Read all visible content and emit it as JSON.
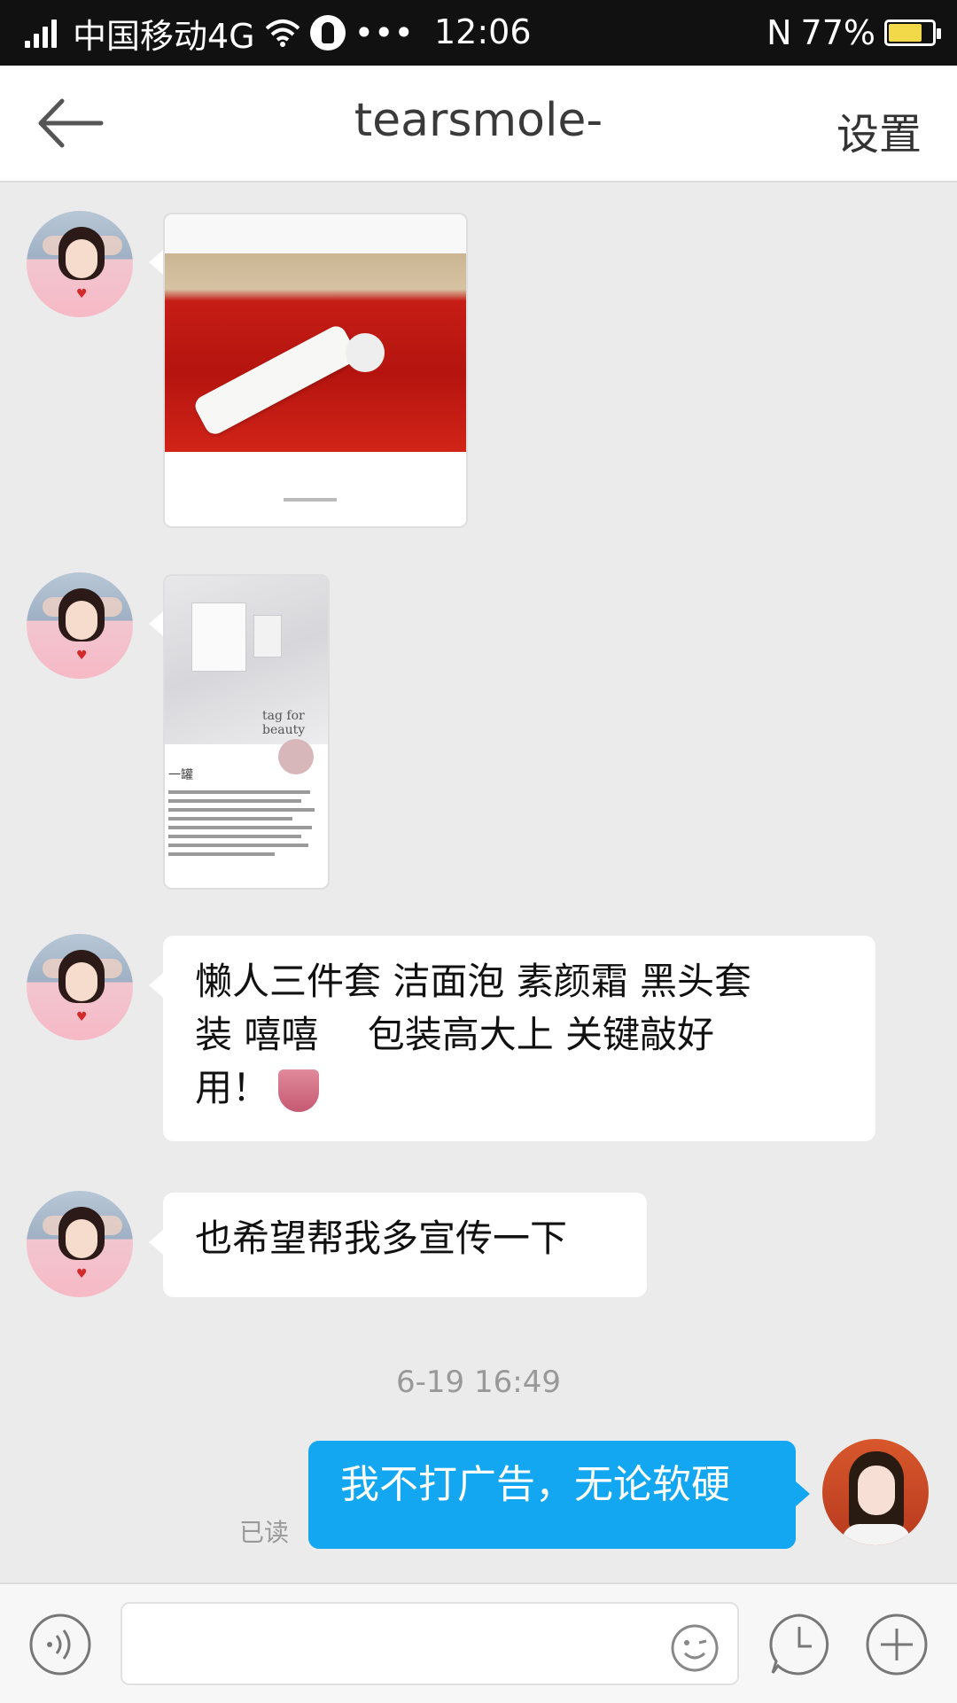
{
  "status_bar": {
    "carrier": "中国移动4G",
    "dots": "•••",
    "time": "12:06",
    "nfc": "N",
    "battery": "77%",
    "battery_level": 0.77
  },
  "header": {
    "title": "tearsmole-",
    "settings_label": "设置"
  },
  "messages": {
    "m3": {
      "line1": "懒人三件套 洁面泡 素颜霜 黑头套",
      "line2": "装 嘻嘻　 包装高大上 关键敲好",
      "line3": "用！"
    },
    "m4": "也希望帮我多宣传一下",
    "time_separator": "6-19 16:49",
    "m5": "我不打广告，无论软硬",
    "read_label": "已读"
  },
  "image2_texts": {
    "brand": "tag for beauty",
    "title": "一罐"
  },
  "colors": {
    "accent": "#12a7f0",
    "background": "#ebebeb"
  },
  "icons": {
    "back": "back-arrow-icon",
    "voice": "voice-icon",
    "emoji": "emoji-icon",
    "history": "clock-icon",
    "more": "plus-icon"
  },
  "input": {
    "value": ""
  }
}
